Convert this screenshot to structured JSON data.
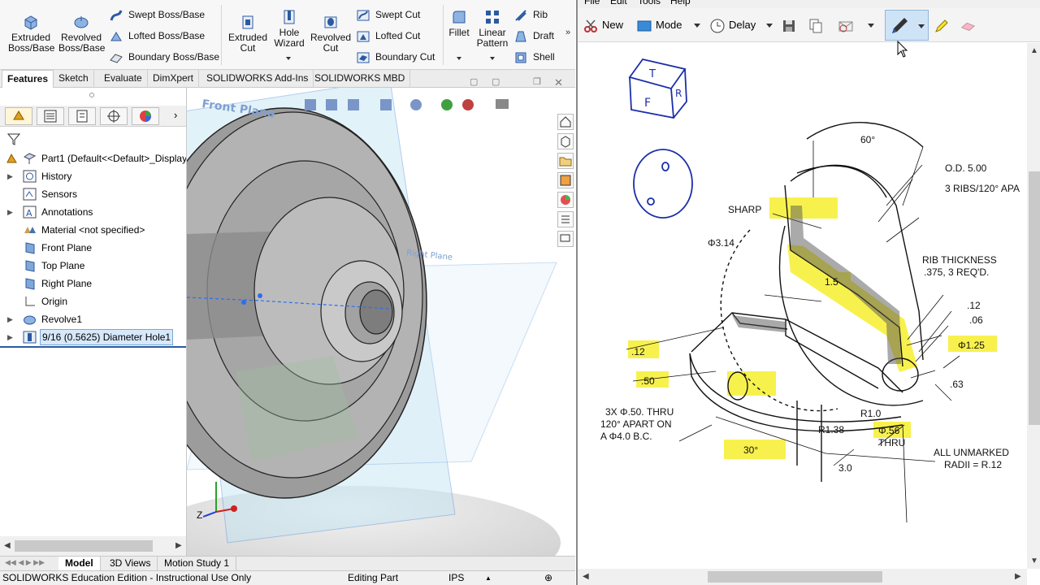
{
  "ribbon": {
    "extruded_boss": "Extruded\nBoss/Base",
    "revolved_boss": "Revolved\nBoss/Base",
    "swept_boss": "Swept Boss/Base",
    "lofted_boss": "Lofted Boss/Base",
    "boundary_boss": "Boundary Boss/Base",
    "extruded_cut": "Extruded\nCut",
    "hole_wizard": "Hole\nWizard",
    "revolved_cut": "Revolved\nCut",
    "swept_cut": "Swept Cut",
    "lofted_cut": "Lofted Cut",
    "boundary_cut": "Boundary Cut",
    "fillet": "Fillet",
    "linear_pattern": "Linear\nPattern",
    "rib": "Rib",
    "draft": "Draft",
    "shell": "Shell"
  },
  "command_tabs": [
    "Features",
    "Sketch",
    "Evaluate",
    "DimXpert",
    "SOLIDWORKS Add-Ins",
    "SOLIDWORKS MBD"
  ],
  "tree": {
    "root": "Part1  (Default<<Default>_Display",
    "items": [
      {
        "label": "History"
      },
      {
        "label": "Sensors"
      },
      {
        "label": "Annotations"
      },
      {
        "label": "Material <not specified>"
      },
      {
        "label": "Front Plane"
      },
      {
        "label": "Top Plane"
      },
      {
        "label": "Right Plane"
      },
      {
        "label": "Origin"
      },
      {
        "label": "Revolve1"
      },
      {
        "label": "9/16 (0.5625) Diameter Hole1"
      }
    ]
  },
  "viewport": {
    "front_plane_label": "Front Plane",
    "right_plane_label": "Right Plane"
  },
  "bottom_tabs": [
    "Model",
    "3D Views",
    "Motion Study 1"
  ],
  "status": {
    "edition": "SOLIDWORKS Education Edition - Instructional Use Only",
    "mode": "Editing Part",
    "units": "IPS"
  },
  "draw": {
    "menu": [
      "File",
      "Edit",
      "Tools",
      "Help"
    ],
    "new_label": "New",
    "mode_label": "Mode",
    "delay_label": "Delay"
  },
  "drawing_notes": {
    "angle60": "60°",
    "od": "O.D. 5.00",
    "ribs": "3 RIBS/120° APA",
    "sharp": "SHARP",
    "d314": "Φ3.14",
    "rib_thickness": "RIB THICKNESS",
    "rib_req": ".375, 3 REQ'D.",
    "v15": "1.5",
    "v12a": ".12",
    "v06": ".06",
    "v12b": ".12",
    "d125": "Φ1.25",
    "v50": ".50",
    "v63": ".63",
    "holes1": "3X Φ.50. THRU",
    "holes2": "120° APART ON",
    "holes3": "A Φ4.0 B.C.",
    "r10": "R1.0",
    "r138": "R1.38",
    "d56": "Φ.56",
    "thru": "THRU",
    "a30": "30°",
    "v30": "3.0",
    "unmarked1": "ALL UNMARKED",
    "unmarked2": "RADII = R.12",
    "cube_top": "T",
    "cube_front": "F",
    "cube_side": "R"
  },
  "colors": {
    "highlight": "#f7f03a",
    "ink": "#1b2fa8",
    "selection": "#d7e8fb"
  }
}
